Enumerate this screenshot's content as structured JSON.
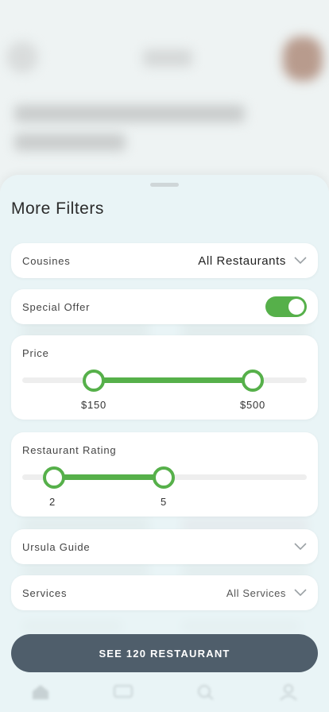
{
  "sheet": {
    "title": "More Filters",
    "cta_label": "SEE 120 RESTAURANT"
  },
  "filters": {
    "cousines": {
      "label": "Cousines",
      "value": "All Restaurants"
    },
    "special_offer": {
      "label": "Special Offer",
      "enabled": true
    },
    "price": {
      "label": "Price",
      "min_label": "$150",
      "max_label": "$500"
    },
    "rating": {
      "label": "Restaurant Rating",
      "min_label": "2",
      "max_label": "5"
    },
    "ursula_guide": {
      "label": "Ursula Guide"
    },
    "services": {
      "label": "Services",
      "value": "All Services"
    }
  },
  "colors": {
    "accent": "#56b04a",
    "cta": "#4f5e6b",
    "sheet_bg": "#e8f4f6"
  },
  "icons": [
    "chevron-down-icon",
    "home-icon",
    "chat-icon",
    "search-icon",
    "profile-icon"
  ]
}
